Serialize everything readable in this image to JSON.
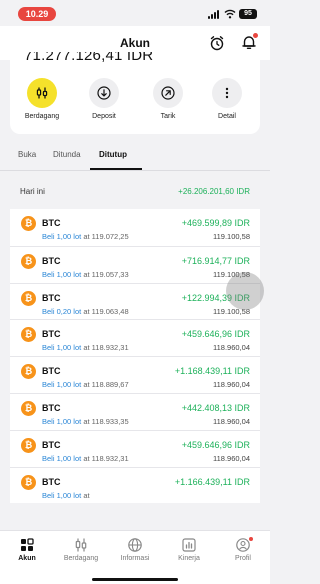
{
  "status_bar": {
    "time": "10.29",
    "battery": "95"
  },
  "header": {
    "title": "Akun"
  },
  "account": {
    "balance": "71.277.126,41 IDR"
  },
  "actions": [
    {
      "label": "Berdagang",
      "icon": "chart-candles-icon"
    },
    {
      "label": "Deposit",
      "icon": "arrow-down-circle-icon"
    },
    {
      "label": "Tarik",
      "icon": "arrow-up-right-circle-icon"
    },
    {
      "label": "Detail",
      "icon": "more-vertical-icon"
    }
  ],
  "tabs": [
    {
      "label": "Buka",
      "active": false
    },
    {
      "label": "Ditunda",
      "active": false
    },
    {
      "label": "Ditutup",
      "active": true
    }
  ],
  "day_group": {
    "label": "Hari ini",
    "total": "+26.206.201,60 IDR"
  },
  "trades": [
    {
      "symbol": "BTC",
      "side": "Beli",
      "lot": "1,00 lot",
      "open_price": "119.072,25",
      "pnl": "+469.599,89 IDR",
      "close_price": "119.100,58"
    },
    {
      "symbol": "BTC",
      "side": "Beli",
      "lot": "1,00 lot",
      "open_price": "119.057,33",
      "pnl": "+716.914,77 IDR",
      "close_price": "119.100,58"
    },
    {
      "symbol": "BTC",
      "side": "Beli",
      "lot": "0,20 lot",
      "open_price": "119.063,48",
      "pnl": "+122.994,39 IDR",
      "close_price": "119.100,58"
    },
    {
      "symbol": "BTC",
      "side": "Beli",
      "lot": "1,00 lot",
      "open_price": "118.932,31",
      "pnl": "+459.646,96 IDR",
      "close_price": "118.960,04"
    },
    {
      "symbol": "BTC",
      "side": "Beli",
      "lot": "1,00 lot",
      "open_price": "118.889,67",
      "pnl": "+1.168.439,11 IDR",
      "close_price": "118.960,04"
    },
    {
      "symbol": "BTC",
      "side": "Beli",
      "lot": "1,00 lot",
      "open_price": "118.933,35",
      "pnl": "+442.408,13 IDR",
      "close_price": "118.960,04"
    },
    {
      "symbol": "BTC",
      "side": "Beli",
      "lot": "1,00 lot",
      "open_price": "118.932,31",
      "pnl": "+459.646,96 IDR",
      "close_price": "118.960,04"
    },
    {
      "symbol": "BTC",
      "side": "Beli",
      "lot": "1,00 lot",
      "open_price": "",
      "pnl": "+1.166.439,11 IDR",
      "close_price": ""
    }
  ],
  "trade_sub_at": "at",
  "bottom_nav": [
    {
      "label": "Akun",
      "icon": "grid-icon",
      "active": true
    },
    {
      "label": "Berdagang",
      "icon": "chart-candles-icon",
      "active": false
    },
    {
      "label": "Informasi",
      "icon": "globe-icon",
      "active": false
    },
    {
      "label": "Kinerja",
      "icon": "bar-chart-icon",
      "active": false
    },
    {
      "label": "Profil",
      "icon": "profile-icon",
      "active": false
    }
  ],
  "colors": {
    "accent_yellow": "#f5e12b",
    "profit_green": "#1db15a",
    "buy_blue": "#2a86d6",
    "bitcoin_orange": "#f7931a",
    "time_red": "#e8463f"
  }
}
